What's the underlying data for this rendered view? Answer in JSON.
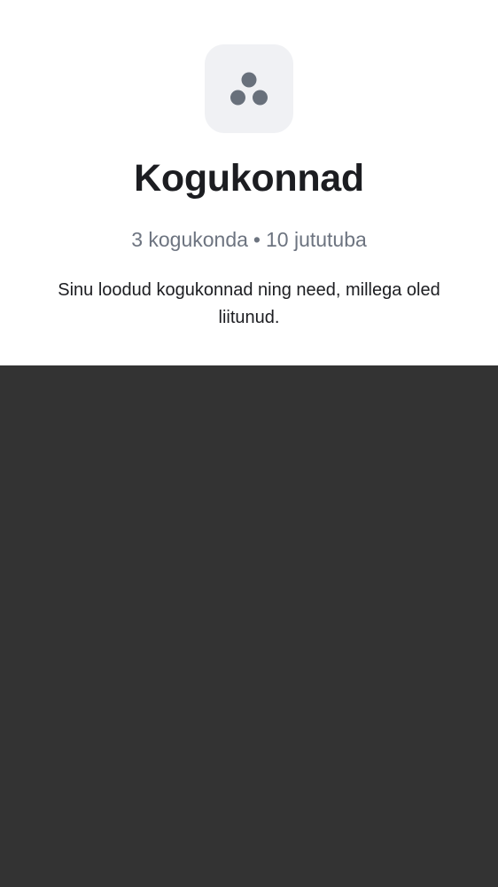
{
  "header": {
    "icon": "communities-icon",
    "title": "Kogukonnad",
    "stats": {
      "communities": "3 kogukonda",
      "separator": "•",
      "rooms": "10 jututuba"
    },
    "description": "Sinu loodud kogukonnad ning need, millega oled liitunud."
  },
  "colors": {
    "background_dark": "#333333",
    "panel": "#ffffff",
    "icon_tile": "#f0f1f4",
    "icon_dots": "#68707b",
    "title": "#1c1d21",
    "muted_text": "#6d7480"
  }
}
